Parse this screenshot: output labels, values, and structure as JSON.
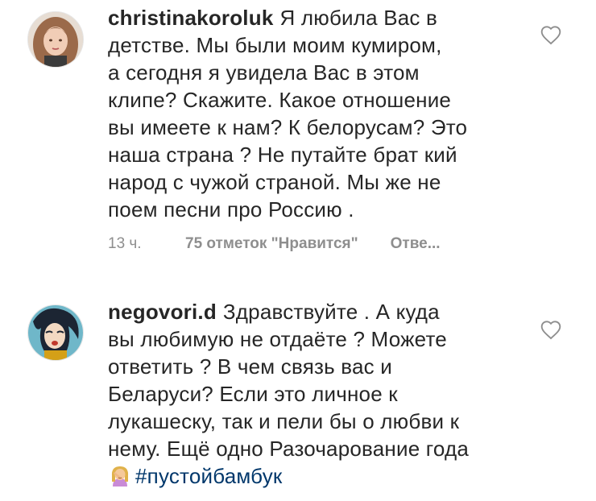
{
  "comments": [
    {
      "username": "christinakoroluk",
      "text_lines": [
        "Я любила Вас в",
        "детстве. Мы были моим кумиром,",
        "а сегодня я увидела Вас в этом",
        "клипе? Скажите. Какое отношение",
        "вы имеете к нам? К белорусам? Это",
        "наша страна ? Не путайте брат кий",
        "народ с чужой страной. Мы же не",
        "поем песни про Россию ."
      ],
      "time": "13 ч.",
      "likes": "75 отметок \"Нравится\"",
      "reply": "Отве..."
    },
    {
      "username": "negovori.d",
      "text_lines": [
        "Здравствуйте . А куда",
        "вы любимую не отдаёте ? Можете",
        "ответить ? В чем связь вас и",
        "Беларуси? Если это личное к",
        "лукашеску, так и пели бы о любви к",
        "нему. Ещё одно Разочарование года"
      ],
      "hashtag": "#пустойбамбук"
    }
  ],
  "icons": {
    "like": "heart-outline-icon",
    "emoji": "woman-facepalming-emoji"
  },
  "colors": {
    "text": "#262626",
    "secondary": "#8e8e8e",
    "hashtag": "#00376b"
  }
}
